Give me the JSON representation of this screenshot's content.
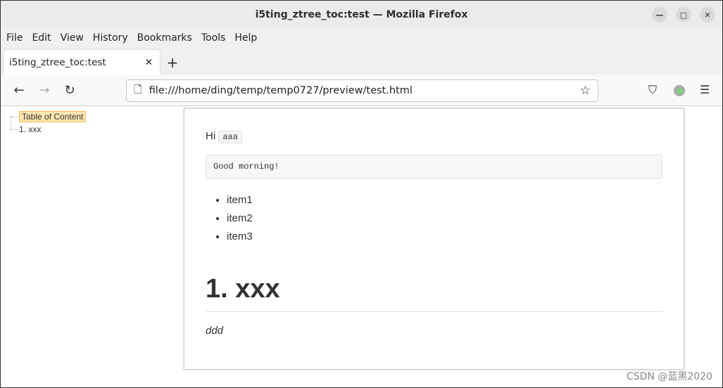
{
  "window": {
    "title": "i5ting_ztree_toc:test — Mozilla Firefox"
  },
  "menu": [
    "File",
    "Edit",
    "View",
    "History",
    "Bookmarks",
    "Tools",
    "Help"
  ],
  "tab": {
    "label": "i5ting_ztree_toc:test"
  },
  "url": "file:///home/ding/temp/temp0727/preview/test.html",
  "toc": {
    "title": "Table of Content",
    "items": [
      "1. xxx"
    ]
  },
  "doc": {
    "hi": "Hi",
    "code": "aaa",
    "pre": "Good morning!",
    "list": [
      "item1",
      "item2",
      "item3"
    ],
    "heading": "1. xxx",
    "em": "ddd"
  },
  "watermark": "CSDN @蓝黑2020",
  "colors": {
    "toc_highlight": "#ffe6b0",
    "extension_dot": "#7ed07e"
  }
}
